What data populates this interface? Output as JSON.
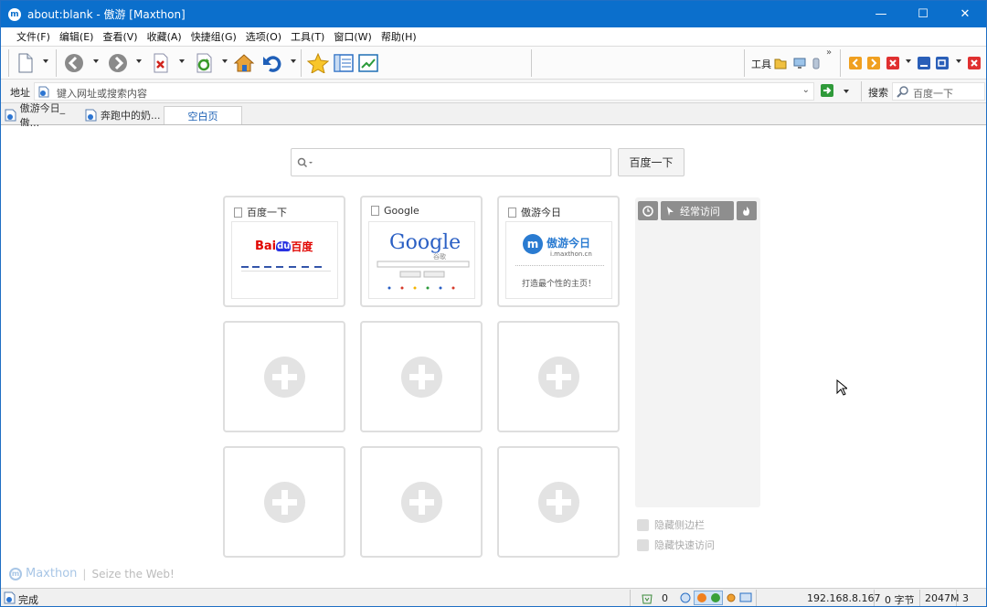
{
  "window": {
    "title": "about:blank - 傲游 [Maxthon]",
    "logo_letter": "m",
    "controls": {
      "minimize": "—",
      "maximize": "☐",
      "close": "✕"
    }
  },
  "menu": [
    "文件(F)",
    "编辑(E)",
    "查看(V)",
    "收藏(A)",
    "快捷组(G)",
    "选项(O)",
    "工具(T)",
    "窗口(W)",
    "帮助(H)"
  ],
  "toolbar": {
    "tools_label": "工具",
    "overflow": "»",
    "icons": [
      "new-page-icon",
      "back-icon",
      "forward-icon",
      "stop-icon",
      "refresh-icon",
      "home-icon",
      "undo-icon",
      "favorites-star-icon",
      "sidebar-panel-icon",
      "screenshot-icon"
    ]
  },
  "address": {
    "label": "地址",
    "placeholder": "键入网址或搜索内容",
    "search_label": "搜索",
    "search_placeholder": "百度一下"
  },
  "tabs": [
    {
      "label": "傲游今日_傲..."
    },
    {
      "label": "奔跑中的奶..."
    },
    {
      "label": "空白页"
    }
  ],
  "speeddial": {
    "search_button": "百度一下",
    "cards": [
      {
        "title": "百度一下",
        "thumb": "baidu"
      },
      {
        "title": "Google",
        "thumb": "google"
      },
      {
        "title": "傲游今日",
        "thumb": "maxthon",
        "caption": "打造最个性的主页！",
        "domain": "i.maxthon.cn",
        "logo_text": "傲游今日"
      }
    ],
    "baidu_logo": {
      "left": "Bai",
      "mid": "du",
      "right": "百度"
    },
    "google_logo": "Google",
    "google_sub": "谷歌",
    "side_panel": {
      "frequent_label": "经常访问"
    },
    "links": [
      {
        "label": "隐藏侧边栏"
      },
      {
        "label": "隐藏快速访问"
      }
    ]
  },
  "watermark": {
    "brand": "Maxthon",
    "slogan": "Seize the Web!"
  },
  "status": {
    "text": "完成",
    "count": "0",
    "ip": "192.168.8.167",
    "bytes": "0 字节",
    "memory": "2047M",
    "num": "3"
  },
  "colors": {
    "titlebar": "#0b6fcc",
    "baidu_red": "#e10602",
    "baidu_blue": "#2932e1",
    "maxthon_blue": "#2a7bd1"
  }
}
